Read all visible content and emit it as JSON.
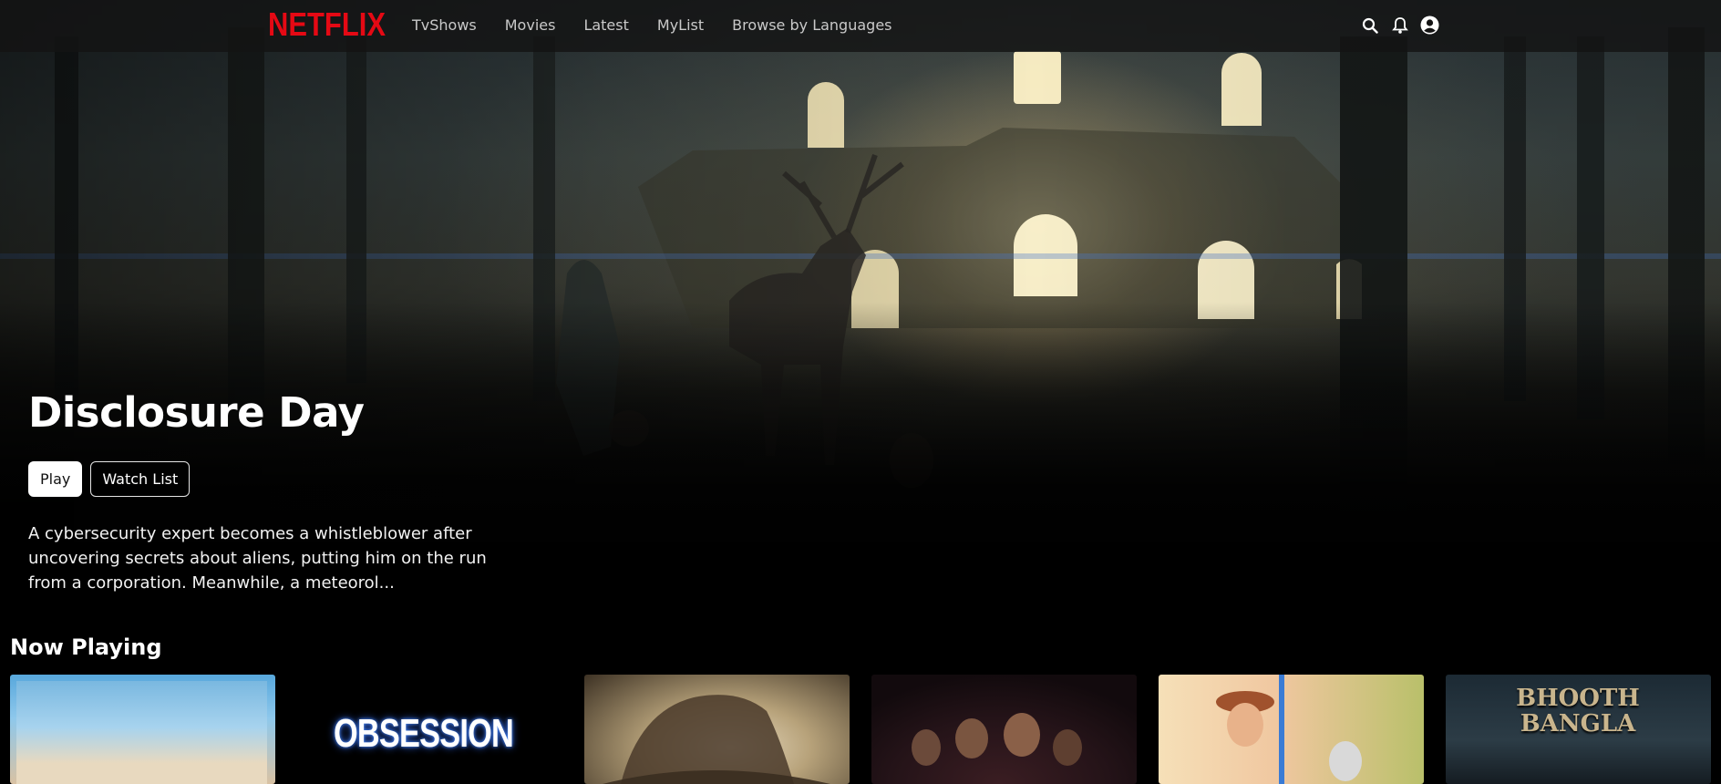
{
  "brand": {
    "logo": "NETFLIX",
    "accent_color": "#e50914"
  },
  "nav": {
    "links": [
      "TvShows",
      "Movies",
      "Latest",
      "MyList",
      "Browse by Languages"
    ],
    "icons": [
      "search-icon",
      "bell-icon",
      "user-circle-icon"
    ]
  },
  "hero": {
    "title": "Disclosure Day",
    "play_label": "Play",
    "watchlist_label": "Watch List",
    "description": "A cybersecurity expert becomes a whistleblower after uncovering secrets about aliens, putting him on the run from a corporation. Meanwhile, a meteorol..."
  },
  "now_playing": {
    "title": "Now Playing",
    "cards": [
      {
        "text": ""
      },
      {
        "text": "OBSESSION"
      },
      {
        "text": ""
      },
      {
        "text": ""
      },
      {
        "text": ""
      },
      {
        "text": "BHOOTH BANGLA"
      }
    ]
  }
}
